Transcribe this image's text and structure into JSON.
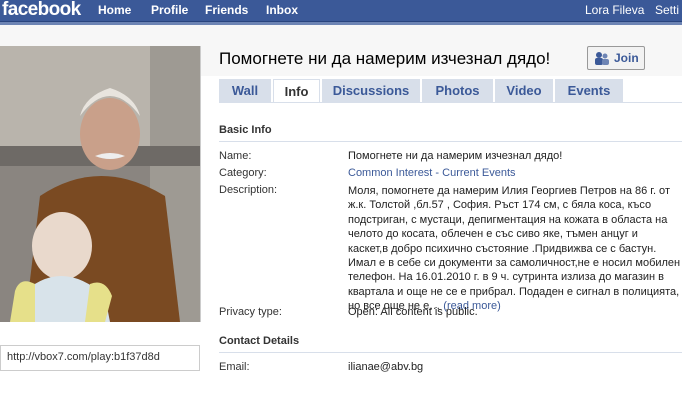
{
  "topbar": {
    "logo": "facebook",
    "nav": [
      "Home",
      "Profile",
      "Friends",
      "Inbox"
    ],
    "user": "Lora Fileva",
    "settings": "Setti"
  },
  "group": {
    "title": "Помогнете ни да намерим изчезнал дядо!",
    "join_label": "Join"
  },
  "tabs": [
    "Wall",
    "Info",
    "Discussions",
    "Photos",
    "Video",
    "Events"
  ],
  "active_tab": "Info",
  "basic_info": {
    "heading": "Basic Info",
    "name_label": "Name:",
    "name_value": "Помогнете ни да намерим изчезнал дядо!",
    "category_label": "Category:",
    "category_value": "Common Interest - Current Events",
    "description_label": "Description:",
    "description_lines": [
      "Моля, помогнете да намерим Илия Георгиев Петров на 86 г. от",
      "ж.к. Толстой ,бл.57 , София. Ръст 174 см, с бяла коса, късо",
      "подстриган, с мустаци, депигментация на кожата в областа на",
      "челото до косата, облечен е със сиво яке, тъмен анцуг и",
      "каскет,в добро психично състояние .Придвижва се с бастун.",
      "Имал е в себе си документи за самоличност,не е носил мобилен",
      "телефон. На 16.01.2010 г. в 9 ч. сутринта излиза до магазин в",
      "квартала и още не се е прибрал. Подаден е сигнал в полицията,",
      "но все още не е…"
    ],
    "read_more": "(read more)",
    "privacy_label": "Privacy type:",
    "privacy_value": "Open: All content is public."
  },
  "contact": {
    "heading": "Contact Details",
    "email_label": "Email:",
    "email_value": "ilianae@abv.bg"
  },
  "sidebar": {
    "link": "http://vbox7.com/play:b1f37d8d"
  },
  "colors": {
    "brand": "#3b5998",
    "tab_bg": "#d8dfea"
  }
}
